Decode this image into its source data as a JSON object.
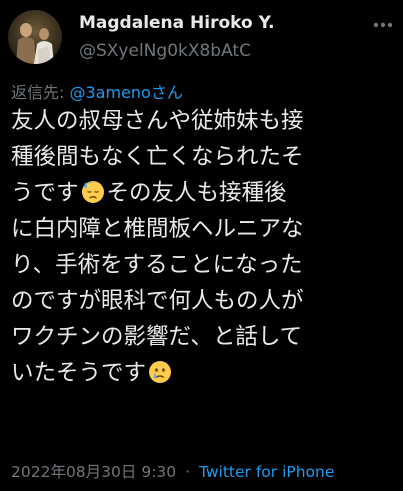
{
  "author": {
    "name": "Magdalena Hiroko Y.",
    "handle": "@SXyelNg0kX8bAtC"
  },
  "reply": {
    "prefix": "返信先:",
    "mention": "@3amenoさん"
  },
  "tweet": {
    "line1": "友人の叔母さんや従姉妹も接",
    "line2": "種後間もなく亡くなられたそ",
    "line3_a": "うです",
    "line3_b": "その友人も接種後",
    "line4": "に白内障と椎間板ヘルニアな",
    "line5": "り、手術をすることになった",
    "line6": "のですが眼科で何人もの人が",
    "line7": "ワクチンの影響だ、と話して",
    "line8": "いたそうです"
  },
  "emojis": {
    "first": "downcast-face-with-sweat",
    "second": "crying-face"
  },
  "meta": {
    "date": "2022年08月30日",
    "time": "9:30",
    "separator": "·",
    "source": "Twitter for iPhone"
  },
  "colors": {
    "background": "#000000",
    "text": "#e7e9ea",
    "secondary": "#71767b",
    "accent": "#1d9bf0"
  }
}
